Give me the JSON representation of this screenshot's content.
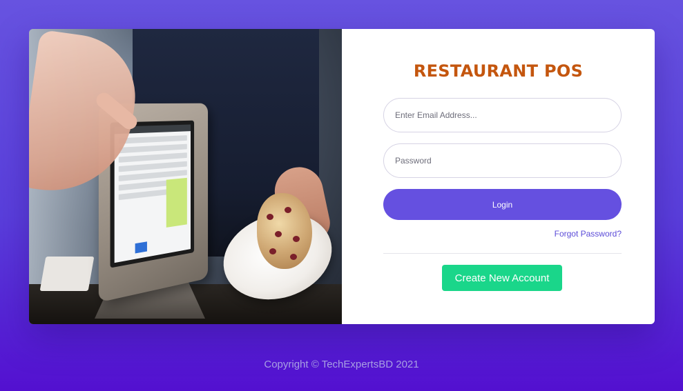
{
  "brand": {
    "title": "RESTAURANT POS",
    "title_color": "#c4560e"
  },
  "login_form": {
    "email": {
      "placeholder": "Enter Email Address...",
      "value": ""
    },
    "password": {
      "placeholder": "Password",
      "value": ""
    },
    "login_label": "Login",
    "forgot_label": "Forgot Password?",
    "create_account_label": "Create New Account"
  },
  "colors": {
    "primary": "#6550e0",
    "success": "#1ad68a",
    "background_top": "#6753e0",
    "background_bottom": "#5310d0"
  },
  "footer": {
    "copyright": "Copyright © TechExpertsBD 2021"
  }
}
